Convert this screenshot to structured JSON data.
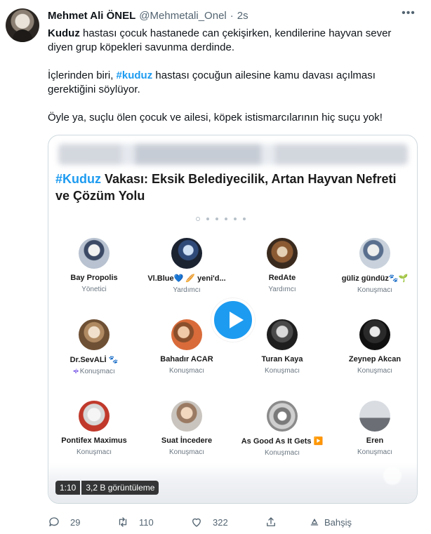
{
  "tweet": {
    "display_name": "Mehmet Ali ÖNEL",
    "handle": "@Mehmetali_Onel",
    "dot": "·",
    "time": "2s",
    "more_icon": "more-horizontal-icon",
    "p1_bold": "Kuduz",
    "p1_rest": " hastası çocuk hastanede can çekişirken, kendilerine hayvan sever diyen grup köpekleri savunma derdinde.",
    "p2_pre": "İçlerinden biri,  ",
    "p2_hashtag": "#kuduz",
    "p2_rest": " hastası çocuğun ailesine kamu davası açılması gerektiğini söylüyor.",
    "p3": "Öyle ya, suçlu ölen çocuk ve ailesi, köpek istismarcılarının hiç suçu yok!"
  },
  "media": {
    "title_hashtag": "#Kuduz",
    "title_rest": " Vakası: Eksik Belediyecilik, Artan Hayvan Nefreti ve Çözüm Yolu",
    "participants": [
      {
        "name": "Bay Propolis",
        "role": "Yönetici"
      },
      {
        "name": "Vl.Blue💙 🥖 yeni'd...",
        "role": "Yardımcı"
      },
      {
        "name": "RedAte",
        "role": "Yardımcı"
      },
      {
        "name": "güliz gündüz🐾🌱",
        "role": "Konuşmacı"
      },
      {
        "name": "Dr.SevALİ 🐾",
        "role": "Konuşmacı"
      },
      {
        "name": "Bahadır ACAR",
        "role": "Konuşmacı"
      },
      {
        "name": "Turan Kaya",
        "role": "Konuşmacı"
      },
      {
        "name": "Zeynep Akcan",
        "role": "Konuşmacı"
      },
      {
        "name": "Pontifex Maximus",
        "role": "Konuşmacı"
      },
      {
        "name": "Suat İncedere",
        "role": "Konuşmacı"
      },
      {
        "name": "As Good As It Gets ▶️",
        "role": "Konuşmacı"
      },
      {
        "name": "Eren",
        "role": "Konuşmacı"
      }
    ],
    "duration": "1:10",
    "views": "3,2 B görüntüleme"
  },
  "actions": {
    "reply_count": "29",
    "retweet_count": "110",
    "like_count": "322",
    "tip_label": "Bahşiş"
  },
  "colors": {
    "accent": "#1d9bf0",
    "muted": "#536471",
    "mic": "#7c5ce6"
  }
}
